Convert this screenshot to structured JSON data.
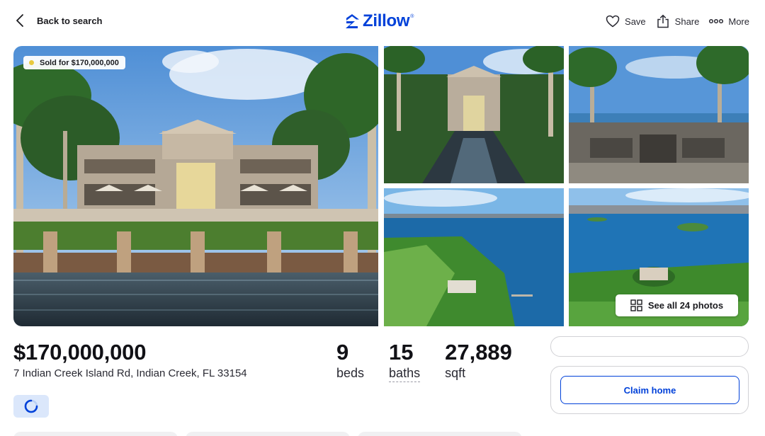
{
  "header": {
    "back_label": "Back to search",
    "logo_text": "Zillow",
    "logo_mark": "®",
    "actions": [
      {
        "label": "Save",
        "icon": "heart-icon"
      },
      {
        "label": "Share",
        "icon": "share-icon"
      },
      {
        "label": "More",
        "icon": "more-dots-icon"
      }
    ]
  },
  "gallery": {
    "sold_badge": "Sold for $170,000,000",
    "see_all_label": "See all 24 photos"
  },
  "listing": {
    "price": "$170,000,000",
    "address": "7 Indian Creek Island Rd, Indian Creek, FL 33154",
    "facts": [
      {
        "value": "9",
        "label": "beds"
      },
      {
        "value": "15",
        "label": "baths"
      },
      {
        "value": "27,889",
        "label": "sqft"
      }
    ]
  },
  "sidebar": {
    "claim_label": "Claim home"
  },
  "colors": {
    "brand": "#0041d9",
    "sold_dot": "#e8c93e",
    "loader_bg": "#dbe7fb"
  }
}
